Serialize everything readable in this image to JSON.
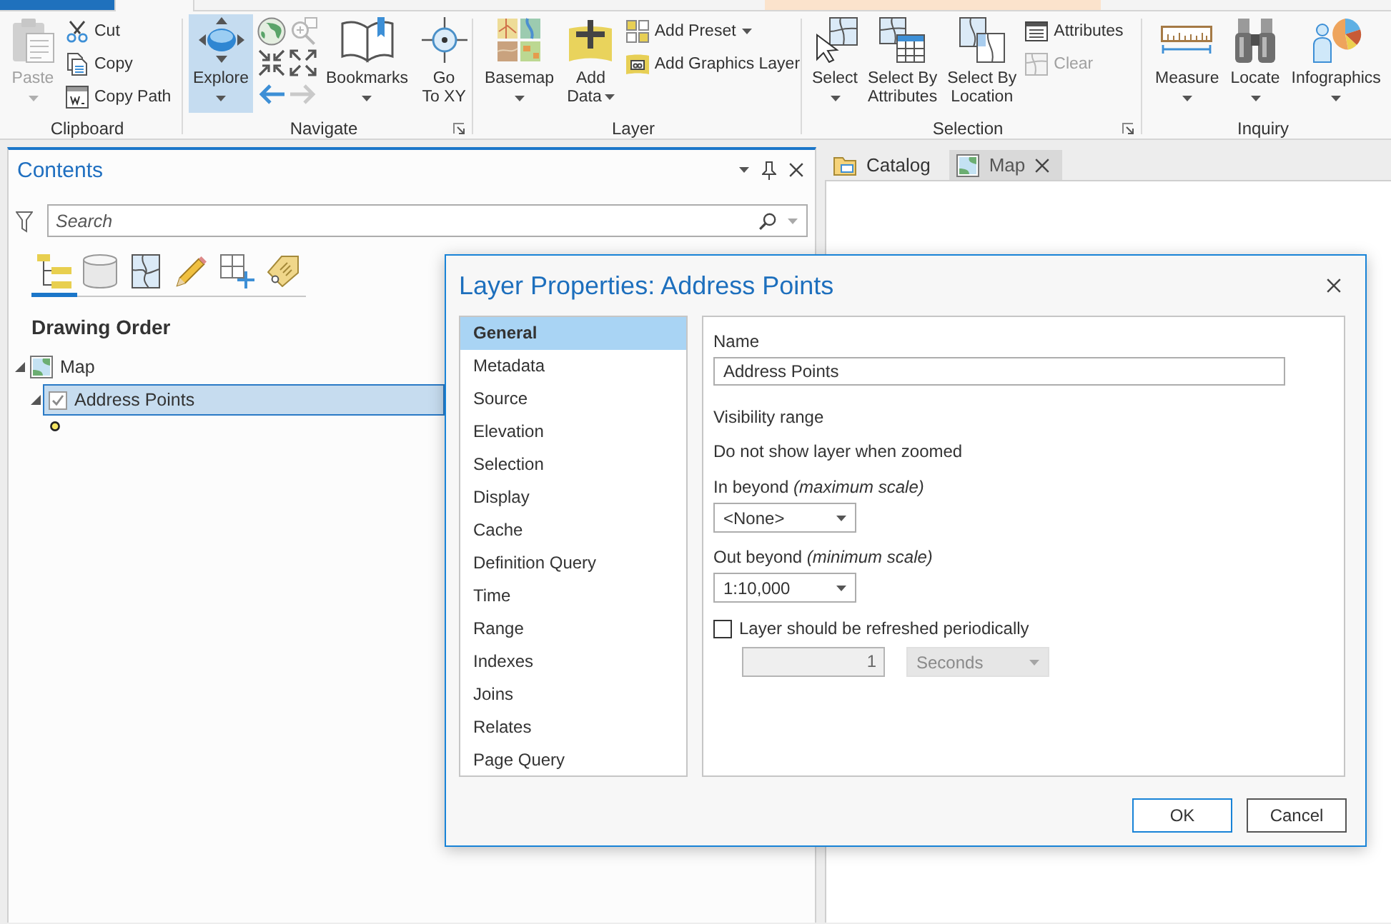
{
  "ribbon_tabs": [
    {
      "kind": "file",
      "selected": false
    },
    {
      "kind": "core",
      "selected": true
    },
    {
      "kind": "contextual",
      "selected": false
    },
    {
      "kind": "contextual",
      "selected": false
    },
    {
      "kind": "contextual",
      "selected": false
    }
  ],
  "ribbon": {
    "groups": [
      {
        "label": "Clipboard",
        "launcher": false,
        "columns": [
          {
            "kind": "large",
            "label": "Paste",
            "dropdown": true,
            "disabled": true,
            "selected": false
          },
          {
            "kind": "stack",
            "items": [
              {
                "label": "Cut",
                "dropdown": false,
                "disabled": false
              },
              {
                "label": "Copy",
                "dropdown": false,
                "disabled": false
              },
              {
                "label": "Copy Path",
                "dropdown": false,
                "disabled": false
              }
            ]
          }
        ]
      },
      {
        "label": "Navigate",
        "launcher": true,
        "columns": [
          {
            "kind": "large",
            "label": "Explore",
            "dropdown": true,
            "disabled": false,
            "selected": true
          },
          {
            "kind": "grid",
            "items": [
              {
                "disabled": false
              },
              {
                "disabled": true
              },
              {
                "disabled": false
              },
              {
                "disabled": false
              },
              {
                "disabled": false
              },
              {
                "disabled": true
              }
            ]
          },
          {
            "kind": "large",
            "label": "Bookmarks",
            "dropdown": true,
            "disabled": false,
            "selected": false
          },
          {
            "kind": "large",
            "label": "Go\nTo XY",
            "dropdown": false,
            "disabled": false,
            "selected": false
          }
        ]
      },
      {
        "label": "Layer",
        "launcher": false,
        "columns": [
          {
            "kind": "large",
            "label": "Basemap",
            "dropdown": true,
            "disabled": false,
            "selected": false
          },
          {
            "kind": "large",
            "label": "Add\nData",
            "dropdown": true,
            "disabled": false,
            "selected": false
          },
          {
            "kind": "stack",
            "items": [
              {
                "label": "Add Preset",
                "dropdown": true,
                "disabled": false
              },
              {
                "label": "Add Graphics Layer",
                "dropdown": false,
                "disabled": false
              }
            ]
          }
        ]
      },
      {
        "label": "Selection",
        "launcher": true,
        "columns": [
          {
            "kind": "large",
            "label": "Select",
            "dropdown": true,
            "disabled": false,
            "selected": false
          },
          {
            "kind": "large",
            "label": "Select By\nAttributes",
            "dropdown": false,
            "disabled": false,
            "selected": false
          },
          {
            "kind": "large",
            "label": "Select By\nLocation",
            "dropdown": false,
            "disabled": false,
            "selected": false
          },
          {
            "kind": "stack",
            "items": [
              {
                "label": "Attributes",
                "dropdown": false,
                "disabled": false
              },
              {
                "label": "Clear",
                "dropdown": false,
                "disabled": true
              }
            ]
          }
        ]
      },
      {
        "label": "Inquiry",
        "launcher": false,
        "columns": [
          {
            "kind": "large",
            "label": "Measure",
            "dropdown": true,
            "disabled": false,
            "selected": false
          },
          {
            "kind": "large",
            "label": "Locate",
            "dropdown": true,
            "disabled": false,
            "selected": false
          },
          {
            "kind": "large",
            "label": "Infographics",
            "dropdown": true,
            "disabled": false,
            "selected": false
          }
        ]
      }
    ]
  },
  "contents": {
    "title": "Contents",
    "search": {
      "placeholder": "Search"
    },
    "view_tabs": [
      {
        "selected": true
      },
      {
        "selected": false
      },
      {
        "selected": false
      },
      {
        "selected": false
      },
      {
        "selected": false
      },
      {
        "selected": false
      }
    ],
    "heading": "Drawing Order",
    "tree": [
      {
        "kind": "map",
        "label": "Map",
        "expanded": true,
        "selected": false,
        "children": [
          {
            "kind": "layer",
            "label": "Address Points",
            "expanded": true,
            "selected": true,
            "checked": true
          }
        ]
      }
    ]
  },
  "views": {
    "tabs": [
      {
        "kind": "catalog",
        "label": "Catalog",
        "selected": false
      },
      {
        "kind": "map",
        "label": "Map",
        "selected": true
      }
    ]
  },
  "dialog": {
    "title": "Layer Properties: Address Points",
    "nav": [
      {
        "label": "General",
        "selected": true
      },
      {
        "label": "Metadata",
        "selected": false
      },
      {
        "label": "Source",
        "selected": false
      },
      {
        "label": "Elevation",
        "selected": false
      },
      {
        "label": "Selection",
        "selected": false
      },
      {
        "label": "Display",
        "selected": false
      },
      {
        "label": "Cache",
        "selected": false
      },
      {
        "label": "Definition Query",
        "selected": false
      },
      {
        "label": "Time",
        "selected": false
      },
      {
        "label": "Range",
        "selected": false
      },
      {
        "label": "Indexes",
        "selected": false
      },
      {
        "label": "Joins",
        "selected": false
      },
      {
        "label": "Relates",
        "selected": false
      },
      {
        "label": "Page Query",
        "selected": false
      }
    ],
    "name": {
      "label": "Name",
      "value": "Address Points"
    },
    "visibility": {
      "heading": "Visibility range",
      "note": "Do not show layer when zoomed",
      "in_beyond": {
        "label": "In beyond *(maximum scale)*",
        "value": "<None>"
      },
      "out_beyond": {
        "label": "Out beyond *(minimum scale)*",
        "value": "1:10,000"
      }
    },
    "refresh": {
      "label": "Layer should be refreshed periodically",
      "checked": false,
      "interval": "1",
      "unit": "Seconds"
    },
    "buttons": [
      {
        "label": "OK",
        "default": true
      },
      {
        "label": "Cancel",
        "default": false
      }
    ]
  }
}
